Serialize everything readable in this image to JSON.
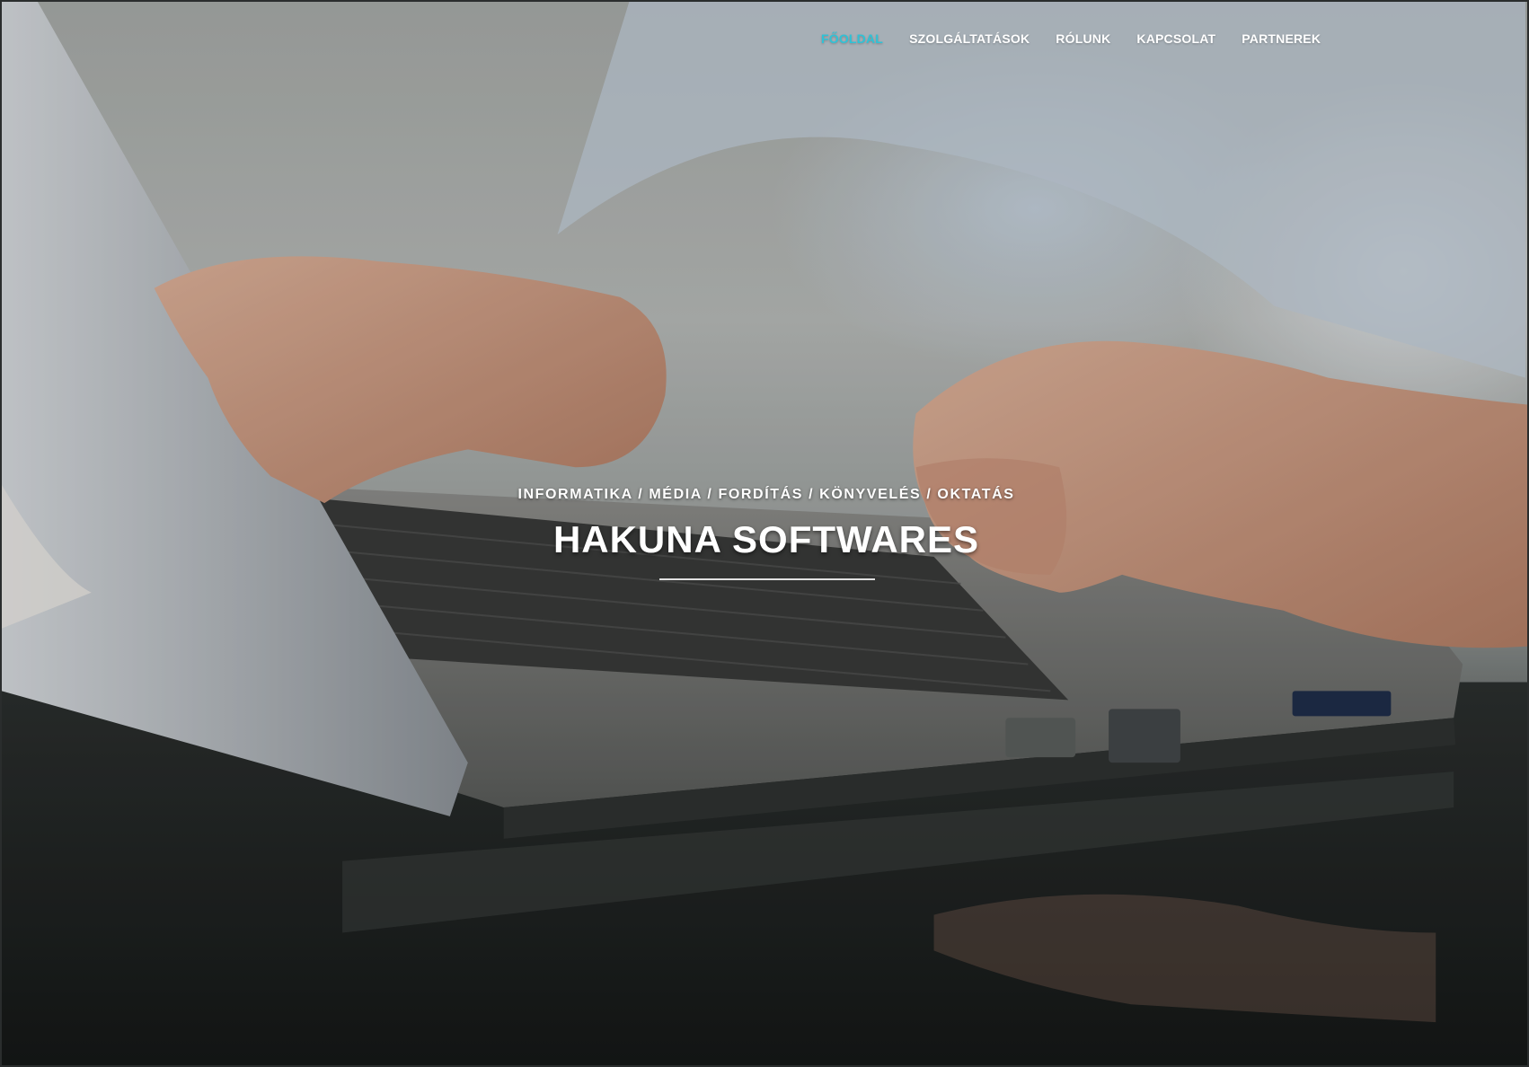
{
  "nav": {
    "items": [
      {
        "label": "FŐOLDAL",
        "active": true
      },
      {
        "label": "SZOLGÁLTATÁSOK",
        "active": false
      },
      {
        "label": "RÓLUNK",
        "active": false
      },
      {
        "label": "KAPCSOLAT",
        "active": false
      },
      {
        "label": "PARTNEREK",
        "active": false
      }
    ],
    "active_color": "#2fc2d6"
  },
  "hero": {
    "tagline": "INFORMATIKA / MÉDIA / FORDÍTÁS / KÖNYVELÉS / OKTATÁS",
    "title": "HAKUNA SOFTWARES"
  }
}
